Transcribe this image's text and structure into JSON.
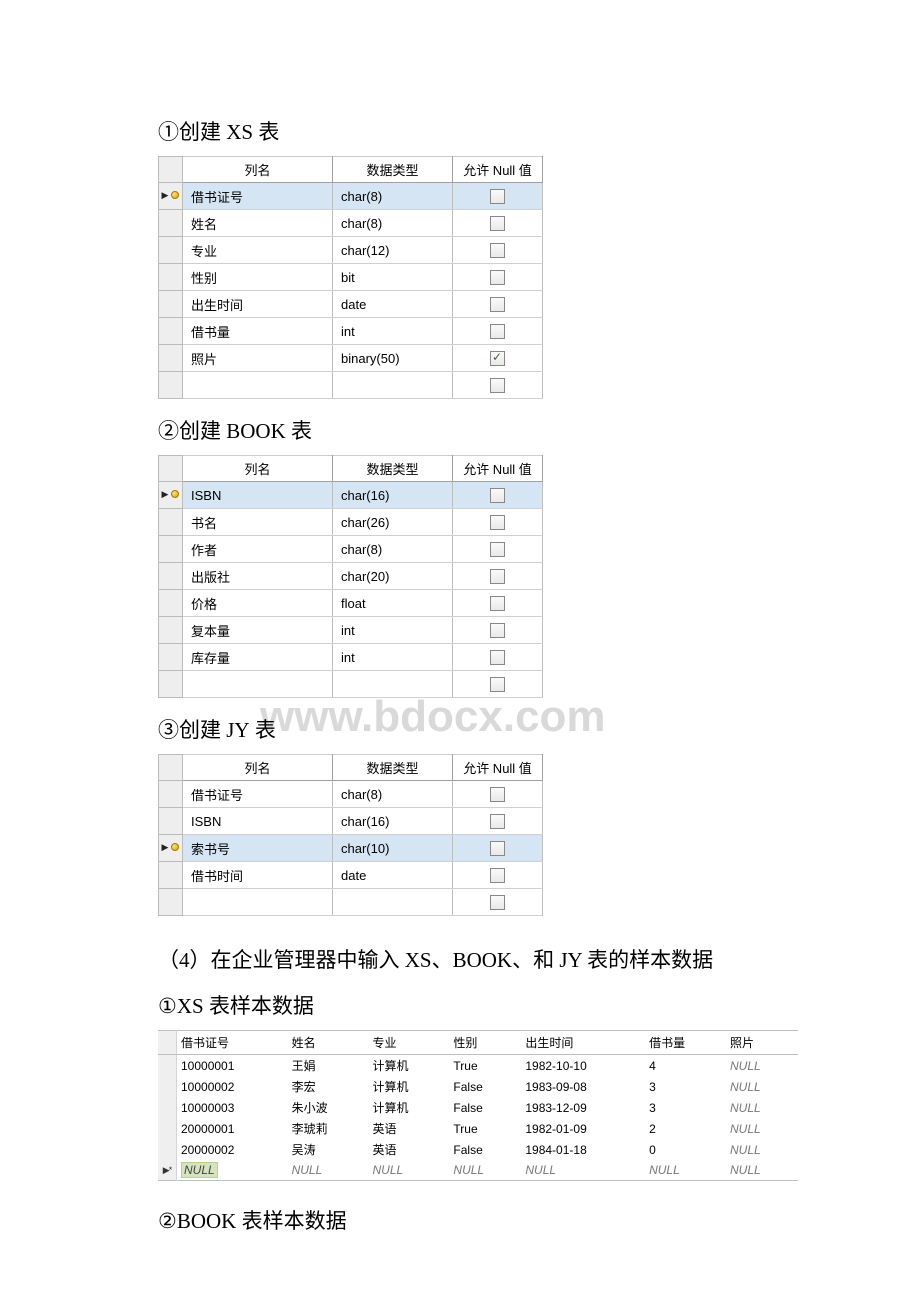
{
  "headings": {
    "h1": {
      "num": "①",
      "text_cn": "创建 ",
      "text_en": "XS",
      "suffix": " 表"
    },
    "h2": {
      "num": "②",
      "text_cn": "创建 ",
      "text_en": "BOOK",
      "suffix": " 表"
    },
    "h3": {
      "num": "③",
      "text_cn": "创建 ",
      "text_en": "JY",
      "suffix": " 表"
    },
    "h4": {
      "num": "（4）",
      "text": "在企业管理器中输入 XS、BOOK、和 JY 表的样本数据"
    },
    "h5": {
      "num": "①",
      "text_en": "XS",
      "suffix": " 表样本数据"
    },
    "h6": {
      "num": "②",
      "text_en": "BOOK",
      "suffix": " 表样本数据"
    }
  },
  "design_headers": {
    "name": "列名",
    "type": "数据类型",
    "null": "允许 Null 值"
  },
  "table_xs": [
    {
      "pk": true,
      "name": "借书证号",
      "type": "char(8)",
      "null": false
    },
    {
      "pk": false,
      "name": "姓名",
      "type": "char(8)",
      "null": false
    },
    {
      "pk": false,
      "name": "专业",
      "type": "char(12)",
      "null": false
    },
    {
      "pk": false,
      "name": "性别",
      "type": "bit",
      "null": false
    },
    {
      "pk": false,
      "name": "出生时间",
      "type": "date",
      "null": false
    },
    {
      "pk": false,
      "name": "借书量",
      "type": "int",
      "null": false
    },
    {
      "pk": false,
      "name": "照片",
      "type": "binary(50)",
      "null": true
    },
    {
      "pk": false,
      "name": "",
      "type": "",
      "null": false
    }
  ],
  "table_book": [
    {
      "pk": true,
      "name": "ISBN",
      "type": "char(16)",
      "null": false
    },
    {
      "pk": false,
      "name": "书名",
      "type": "char(26)",
      "null": false
    },
    {
      "pk": false,
      "name": "作者",
      "type": "char(8)",
      "null": false
    },
    {
      "pk": false,
      "name": "出版社",
      "type": "char(20)",
      "null": false
    },
    {
      "pk": false,
      "name": "价格",
      "type": "float",
      "null": false
    },
    {
      "pk": false,
      "name": "复本量",
      "type": "int",
      "null": false
    },
    {
      "pk": false,
      "name": "库存量",
      "type": "int",
      "null": false
    },
    {
      "pk": false,
      "name": "",
      "type": "",
      "null": false
    }
  ],
  "table_jy": [
    {
      "pk": false,
      "name": "借书证号",
      "type": "char(8)",
      "null": false
    },
    {
      "pk": false,
      "name": "ISBN",
      "type": "char(16)",
      "null": false
    },
    {
      "pk": true,
      "name": "索书号",
      "type": "char(10)",
      "null": false
    },
    {
      "pk": false,
      "name": "借书时间",
      "type": "date",
      "null": false
    },
    {
      "pk": false,
      "name": "",
      "type": "",
      "null": false
    }
  ],
  "sample_headers": [
    "借书证号",
    "姓名",
    "专业",
    "性别",
    "出生时间",
    "借书量",
    "照片"
  ],
  "sample_rows": [
    {
      "c": [
        "10000001",
        "王娟",
        "计算机",
        "True",
        "1982-10-10",
        "4",
        "NULL"
      ]
    },
    {
      "c": [
        "10000002",
        "李宏",
        "计算机",
        "False",
        "1983-09-08",
        "3",
        "NULL"
      ]
    },
    {
      "c": [
        "10000003",
        "朱小波",
        "计算机",
        "False",
        "1983-12-09",
        "3",
        "NULL"
      ]
    },
    {
      "c": [
        "20000001",
        "李琥莉",
        "英语",
        "True",
        "1982-01-09",
        "2",
        "NULL"
      ]
    },
    {
      "c": [
        "20000002",
        "吴涛",
        "英语",
        "False",
        "1984-01-18",
        "0",
        "NULL"
      ]
    }
  ],
  "null_label": "NULL",
  "watermark": "www.bdocx.com"
}
